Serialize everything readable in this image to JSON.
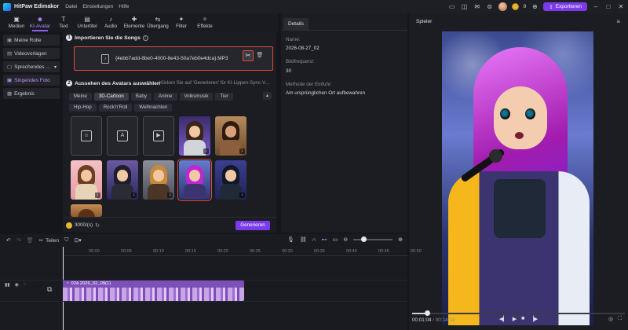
{
  "titlebar": {
    "app_title": "HitPaw Edimakor",
    "menu": [
      "Datei",
      "Einstellungen",
      "Hilfe"
    ],
    "coins": "0",
    "export_label": "Exportieren"
  },
  "toolbar": {
    "tools": [
      {
        "label": "Medien",
        "icon": "▣"
      },
      {
        "label": "KI-Avatar",
        "icon": "☻"
      },
      {
        "label": "Text",
        "icon": "T"
      },
      {
        "label": "Untertitel",
        "icon": "▤"
      },
      {
        "label": "Audio",
        "icon": "♪"
      },
      {
        "label": "Elemente",
        "icon": "✚"
      },
      {
        "label": "Übergang",
        "icon": "⇆"
      },
      {
        "label": "Filter",
        "icon": "✦"
      },
      {
        "label": "Effekte",
        "icon": "✧"
      }
    ]
  },
  "leftnav": {
    "items": [
      {
        "label": "Meine Rolle"
      },
      {
        "label": "Videovorlagen"
      },
      {
        "label": "Sprechendes ..."
      },
      {
        "label": "Singendes Foto"
      },
      {
        "label": "Ergebnis"
      }
    ]
  },
  "step1": {
    "num": "1",
    "title": "Importieren Sie die Songs",
    "file_name": "{4ebb7add-8be0-4000-8e43-50a7eb0e4dca}.MP3"
  },
  "step2": {
    "num": "2",
    "title": "Aussehen des Avatars auswählen",
    "hint": "Klicken Sie auf 'Generieren' für KI-Lippen-Sync-V..."
  },
  "chips_row1": [
    "Meine",
    "3D-Cartoon",
    "Baby",
    "Anime",
    "Volksmusik",
    "Tier"
  ],
  "chips_row2": [
    "Hip-Hop",
    "Rock'n'Roll",
    "Weihnachten"
  ],
  "generate": {
    "cost": "3000/(s)",
    "button_label": "Generieren"
  },
  "details": {
    "tab_label": "Details",
    "name_label": "Name:",
    "name_value": "2026-08-27_02",
    "fps_label": "Bildfrequenz:",
    "fps_value": "30",
    "import_label": "Methode der Einfuhr:",
    "import_value": "Am ursprünglichen Ort aufbewahren"
  },
  "player": {
    "title": "Spieler",
    "current_time": "00:01:04",
    "total_time": "00:14:13",
    "progress": 0.07
  },
  "timeline": {
    "split_label": "Teilen",
    "ruler_labels": [
      "00:00",
      "00:05",
      "00:10",
      "00:15",
      "00:20",
      "00:25",
      "00:30",
      "00:35",
      "00:40",
      "00:45",
      "00:50"
    ],
    "clip_label": "02â 2026_02_09(1)"
  },
  "colors": {
    "accent": "#7c3aed",
    "highlight_border": "#e4473a",
    "background": "#15161b"
  }
}
